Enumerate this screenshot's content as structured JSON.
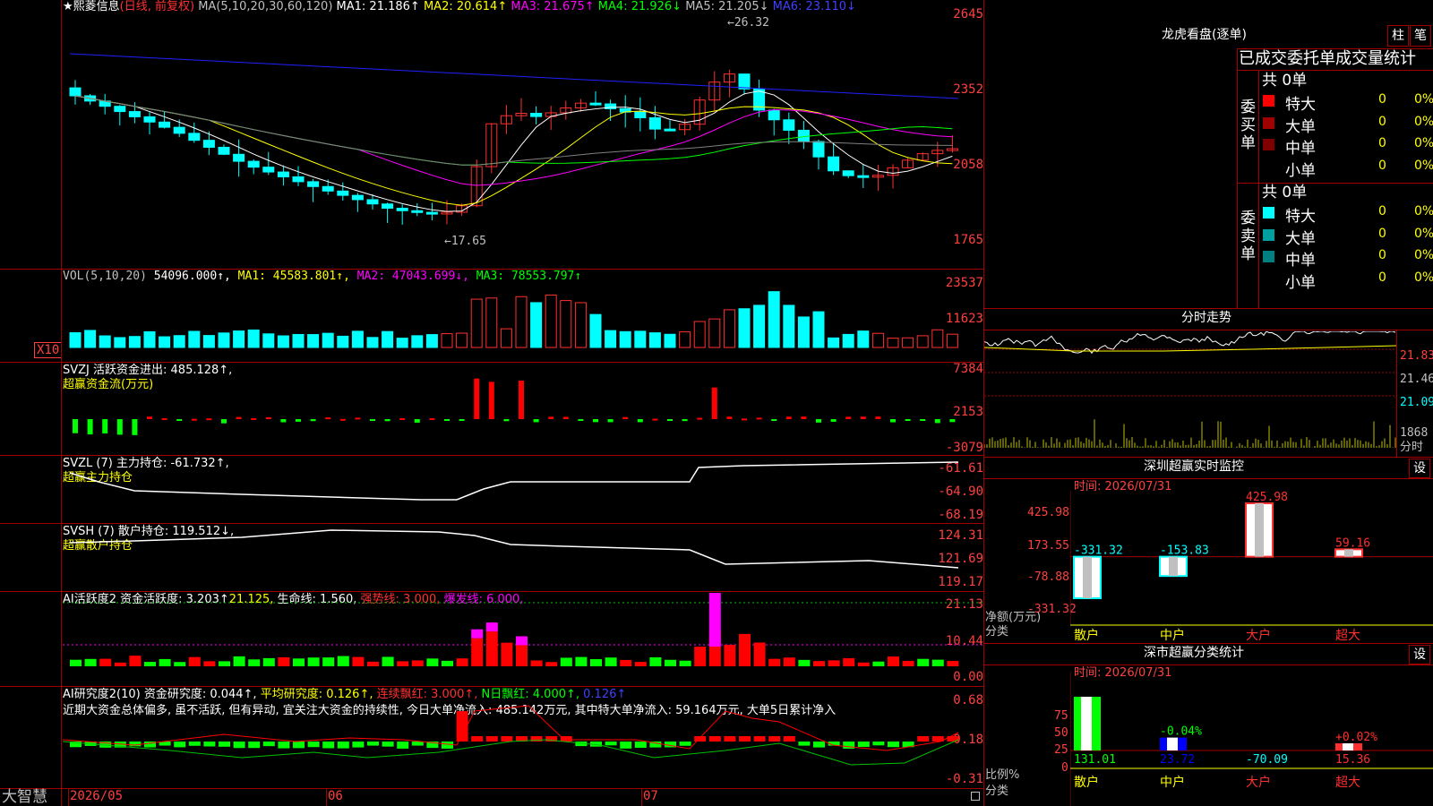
{
  "colors": {
    "up": "#ff3030",
    "down": "#00ffff",
    "bg": "#000000",
    "grid": "#a00000",
    "ma1": "#ffffff",
    "ma2": "#ffff00",
    "ma3": "#ff00ff",
    "ma4": "#00ff00",
    "ma5": "#808080",
    "ma6": "#0000ff"
  },
  "main": {
    "stock_name": "★熙菱信息",
    "period": "(日线, 前复权)",
    "ma_label": "MA(5,10,20,30,60,120)",
    "ma1": "MA1: 21.186↑",
    "ma2": "MA2: 20.614↑",
    "ma3": "MA3: 21.675↑",
    "ma4": "MA4: 21.926↓",
    "ma5": "MA5: 21.205↓",
    "ma6": "MA6: 23.110↓",
    "y_labels": [
      "2645",
      "2352",
      "2058",
      "1765"
    ],
    "high_marker": "←26.32",
    "low_marker": "←17.65"
  },
  "vol": {
    "label": "VOL(5,10,20)",
    "value": "54096.000↑,",
    "ma1": "MA1: 45583.801↑,",
    "ma2": "MA2: 47043.699↓,",
    "ma3": "MA3: 78553.797↑",
    "y_labels": [
      "23537",
      "11623"
    ],
    "unit": "X10"
  },
  "svzj": {
    "label": "SVZJ  活跃资金进出: 485.128↑,",
    "title": "超赢资金流(万元)",
    "y_labels": [
      "7384",
      "2153",
      "-3079"
    ]
  },
  "svzl": {
    "label": "SVZL (7) 主力持仓: -61.732↑,",
    "title": "超赢主力持仓",
    "y_labels": [
      "-61.61",
      "-64.90",
      "-68.19"
    ]
  },
  "svsh": {
    "label": "SVSH (7) 散户持仓: 119.512↓,",
    "title": "超赢散户持仓",
    "y_labels": [
      "124.31",
      "121.69",
      "119.17"
    ]
  },
  "ai_active": {
    "label": "AI活跃度2 资金活跃度: 3.203↑",
    "v2": "21.125,",
    "v3": "生命线: 1.560,",
    "v4": "强势线: 3.000,",
    "v5": "爆发线: 6.000,",
    "y_labels": [
      "21.13",
      "10.44",
      "0.00"
    ]
  },
  "ai_research": {
    "label": "AI研究度2(10) 资金研究度: 0.044↑,",
    "v2": "平均研究度: 0.126↑,",
    "v3": "连续飘红: 3.000↑,",
    "v4": "N日飘红: 4.000↑,",
    "v5": "0.126↑",
    "comment": "近期大资金总体偏多, 虽不活跃, 但有异动, 宜关注大资金的持续性, 今日大单净流入: 485.142万元, 其中特大单净流入: 59.164万元, 大单5日累计净入",
    "y_labels": [
      "0.68",
      "0.18",
      "-0.31"
    ]
  },
  "bottom": {
    "brand": "大智慧",
    "dates": [
      "2026/05",
      "06",
      "07"
    ]
  },
  "right": {
    "lhb_title": "龙虎看盘(逐单)",
    "tab1": "柱",
    "tab2": "笔",
    "stat_title": "已成交委托单成交量统计",
    "buy_side": "委买单",
    "sell_side": "委卖单",
    "buy_total": "共 0单",
    "sell_total": "共 0单",
    "rows": [
      {
        "name": "特大",
        "count": "0",
        "pct": "0%"
      },
      {
        "name": "大单",
        "count": "0",
        "pct": "0%"
      },
      {
        "name": "中单",
        "count": "0",
        "pct": "0%"
      },
      {
        "name": "小单",
        "count": "0",
        "pct": "0%"
      }
    ],
    "fenshi_title": "分时走势",
    "fenshi_prices": [
      "21.83",
      "21.46",
      "21.09"
    ],
    "fenshi_vol": "1868",
    "fenshi_unit": "分时",
    "monitor_title": "深圳超赢实时监控",
    "monitor_time": "时间: 2026/07/31",
    "monitor_y": [
      "425.98",
      "173.55",
      "-78.88",
      "-331.32"
    ],
    "monitor_axis_label1": "净额(万元)",
    "monitor_axis_label2": "分类",
    "stats_title": "深市超赢分类统计",
    "stats_time": "时间: 2026/07/31",
    "stats_y": [
      "75",
      "50",
      "25",
      "0"
    ],
    "stats_axis_label1": "比例%",
    "stats_axis_label2": "分类",
    "settings": "设",
    "categories": [
      "散户",
      "中户",
      "大户",
      "超大"
    ]
  },
  "chart_data": [
    {
      "type": "bar",
      "title": "深圳超赢实时监控",
      "categories": [
        "散户",
        "中户",
        "大户",
        "超大"
      ],
      "values": [
        -331.32,
        -153.83,
        425.98,
        59.16
      ],
      "value_labels": [
        "-331.32",
        "-153.83",
        "425.98",
        "59.16"
      ],
      "ylim": [
        -331.32,
        425.98
      ]
    },
    {
      "type": "bar",
      "title": "深市超赢分类统计",
      "categories": [
        "散户",
        "中户",
        "大户",
        "超大"
      ],
      "series": [
        {
          "values": [
            131.01,
            23.72,
            -70.09,
            15.36
          ]
        },
        {
          "values": [
            null,
            -0.04,
            null,
            0.02
          ]
        }
      ],
      "value_labels": [
        "131.01",
        "23.72",
        "-70.09",
        "15.36"
      ],
      "pct_labels": [
        "",
        "-0.04%",
        "",
        "+0.02%"
      ],
      "ylim": [
        0,
        75
      ]
    }
  ]
}
